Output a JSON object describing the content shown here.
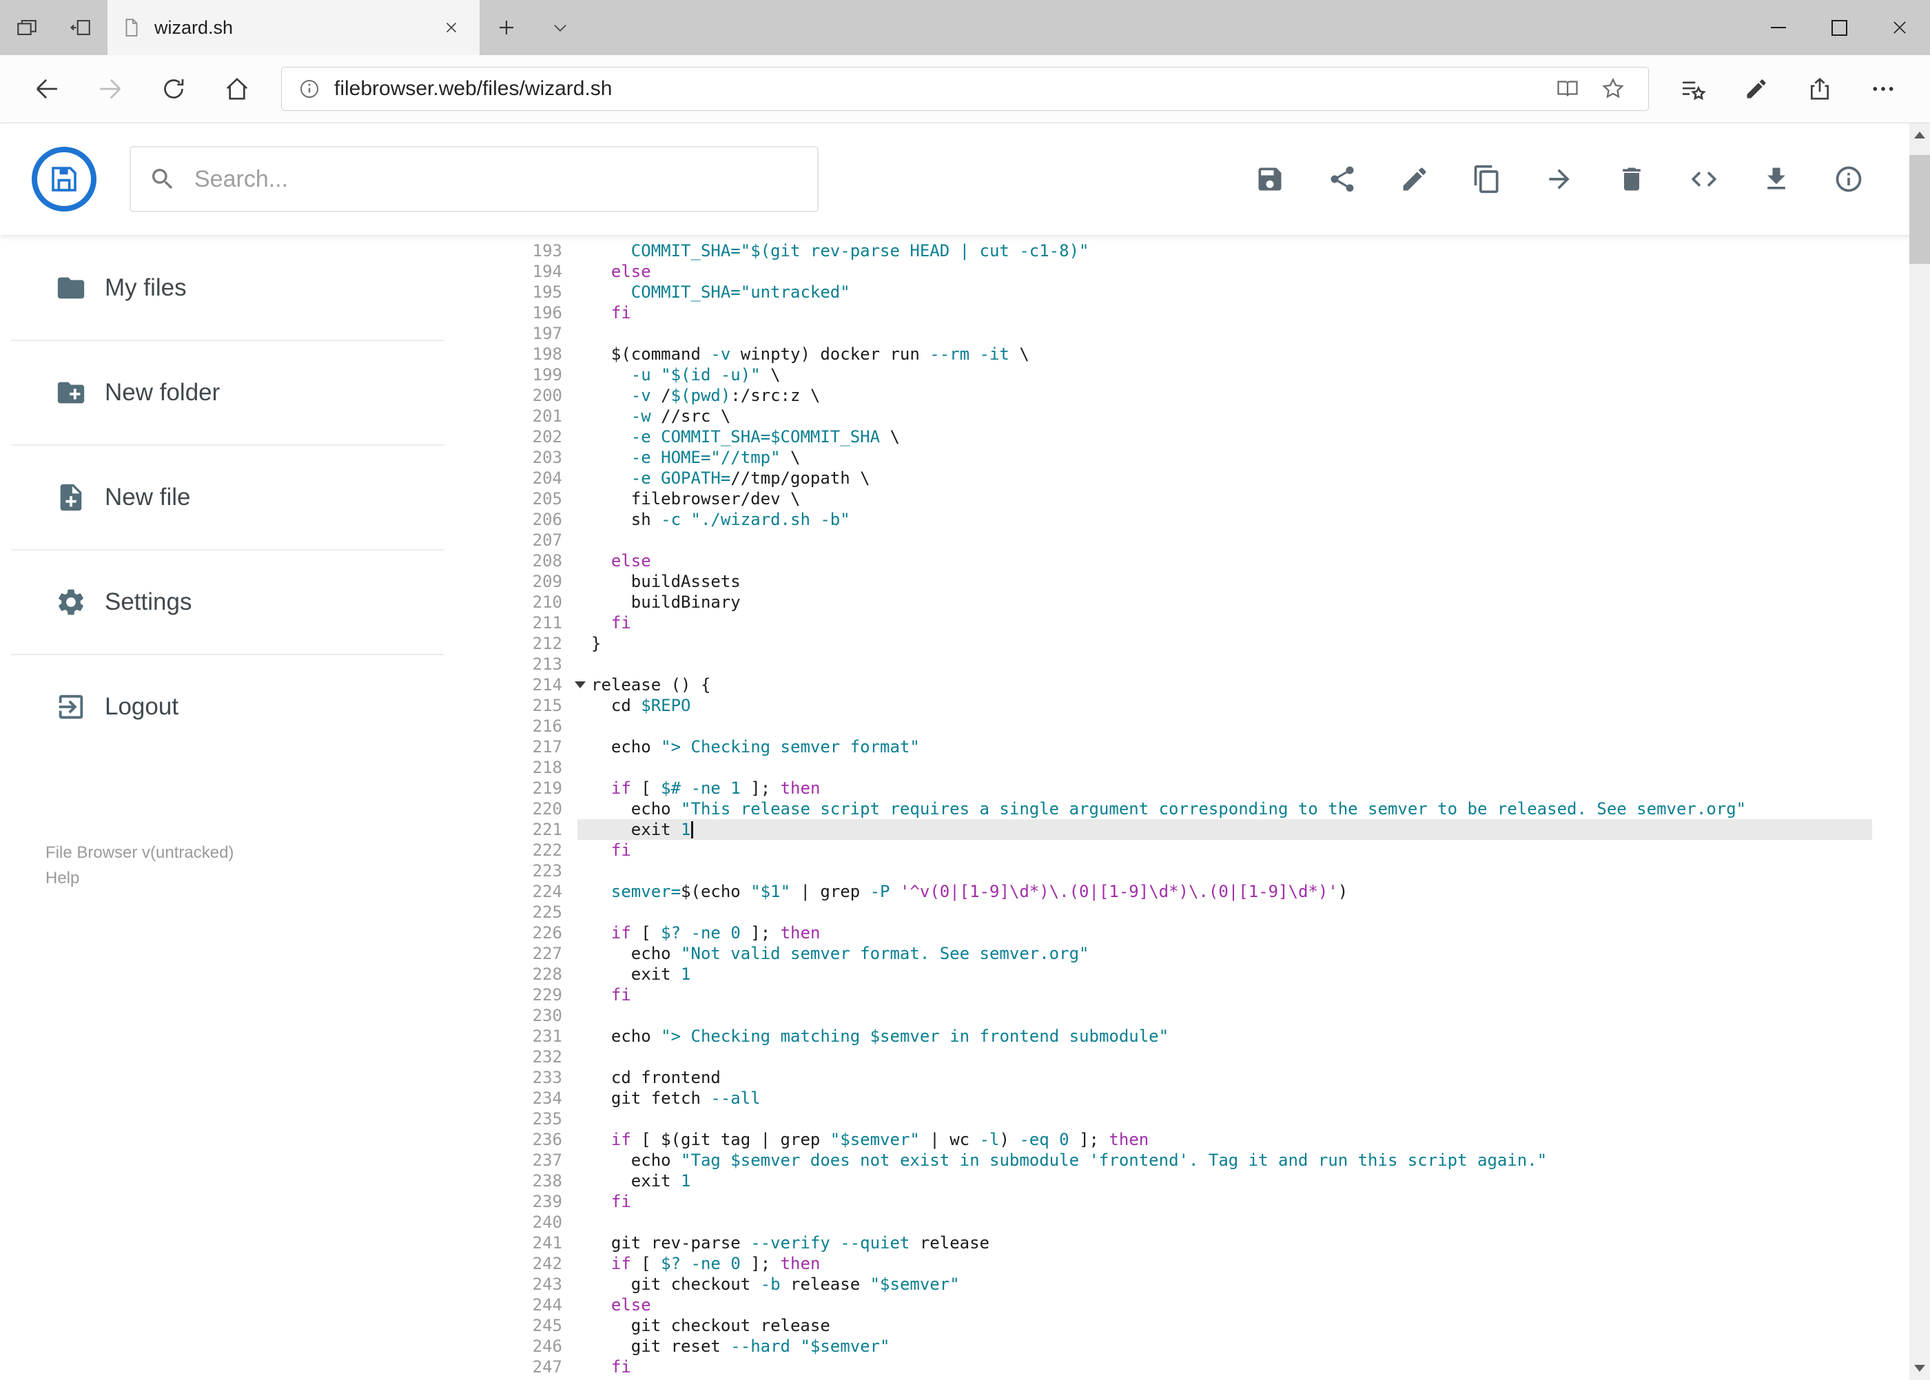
{
  "browser": {
    "tab_title": "wizard.sh",
    "url_domain": "filebrowser.web",
    "url_path": "/files/wizard.sh",
    "tab_bar_icons": [
      "tab-preview",
      "set-tabs-aside",
      "page",
      "close-tab",
      "new-tab",
      "tab-list-chevron"
    ],
    "nav_icons": [
      "back",
      "forward",
      "refresh",
      "home"
    ],
    "address_bar_icons": [
      "site-info",
      "reading-view",
      "favorite-star"
    ],
    "right_icons": [
      "hub-favorites",
      "web-note",
      "share",
      "more-options"
    ],
    "window_controls": [
      "minimize",
      "maximize",
      "close"
    ]
  },
  "header": {
    "search_placeholder": "Search...",
    "action_icons": [
      "save",
      "share",
      "edit",
      "copy",
      "move",
      "delete",
      "code",
      "download",
      "info"
    ]
  },
  "sidebar": {
    "items": [
      {
        "label": "My files",
        "icon": "folder-icon"
      },
      {
        "label": "New folder",
        "icon": "new-folder-icon"
      },
      {
        "label": "New file",
        "icon": "new-file-icon"
      },
      {
        "label": "Settings",
        "icon": "settings-icon"
      },
      {
        "label": "Logout",
        "icon": "logout-icon"
      }
    ],
    "footer_version": "File Browser v(untracked)",
    "footer_help": "Help"
  },
  "colors": {
    "accent_blue": "#1e74d2",
    "toolbar_icon_gray": "#5b6973",
    "sidebar_icon_gray": "#546e7a",
    "keyword_purple": "#a12ea8",
    "string_teal": "#0b7f91",
    "active_line_bg": "#e9e9e9",
    "tab_bar_bg": "#cbcbcb"
  },
  "editor": {
    "first_line": 193,
    "last_line": 247,
    "active_line": 221,
    "cursor_line": 221,
    "cursor_after_text": "exit 1",
    "fold_marker_line": 214,
    "lines": [
      {
        "n": 193,
        "s": [
          [
            "p",
            "    "
          ],
          [
            "v",
            "COMMIT_SHA="
          ],
          [
            "s",
            "\"$(git rev-parse HEAD | cut -c1-8)\""
          ]
        ]
      },
      {
        "n": 194,
        "s": [
          [
            "p",
            "  "
          ],
          [
            "k",
            "else"
          ]
        ]
      },
      {
        "n": 195,
        "s": [
          [
            "p",
            "    "
          ],
          [
            "v",
            "COMMIT_SHA="
          ],
          [
            "s",
            "\"untracked\""
          ]
        ]
      },
      {
        "n": 196,
        "s": [
          [
            "p",
            "  "
          ],
          [
            "k",
            "fi"
          ]
        ]
      },
      {
        "n": 197,
        "s": []
      },
      {
        "n": 198,
        "s": [
          [
            "p",
            "  $(command "
          ],
          [
            "f",
            "-v"
          ],
          [
            "p",
            " winpty) docker run "
          ],
          [
            "f",
            "--rm"
          ],
          [
            "p",
            " "
          ],
          [
            "f",
            "-it"
          ],
          [
            "p",
            " \\"
          ]
        ]
      },
      {
        "n": 199,
        "s": [
          [
            "p",
            "    "
          ],
          [
            "f",
            "-u"
          ],
          [
            "p",
            " "
          ],
          [
            "s",
            "\"$(id -u)\""
          ],
          [
            "p",
            " \\"
          ]
        ]
      },
      {
        "n": 200,
        "s": [
          [
            "p",
            "    "
          ],
          [
            "f",
            "-v"
          ],
          [
            "p",
            " /"
          ],
          [
            "v",
            "$(pwd)"
          ],
          [
            "p",
            ":/src:z \\"
          ]
        ]
      },
      {
        "n": 201,
        "s": [
          [
            "p",
            "    "
          ],
          [
            "f",
            "-w"
          ],
          [
            "p",
            " //src \\"
          ]
        ]
      },
      {
        "n": 202,
        "s": [
          [
            "p",
            "    "
          ],
          [
            "f",
            "-e"
          ],
          [
            "p",
            " "
          ],
          [
            "v",
            "COMMIT_SHA=$COMMIT_SHA"
          ],
          [
            "p",
            " \\"
          ]
        ]
      },
      {
        "n": 203,
        "s": [
          [
            "p",
            "    "
          ],
          [
            "f",
            "-e"
          ],
          [
            "p",
            " "
          ],
          [
            "v",
            "HOME="
          ],
          [
            "s",
            "\"//tmp\""
          ],
          [
            "p",
            " \\"
          ]
        ]
      },
      {
        "n": 204,
        "s": [
          [
            "p",
            "    "
          ],
          [
            "f",
            "-e"
          ],
          [
            "p",
            " "
          ],
          [
            "v",
            "GOPATH="
          ],
          [
            "p",
            "//tmp/gopath \\"
          ]
        ]
      },
      {
        "n": 205,
        "s": [
          [
            "p",
            "    filebrowser/dev \\"
          ]
        ]
      },
      {
        "n": 206,
        "s": [
          [
            "p",
            "    sh "
          ],
          [
            "f",
            "-c"
          ],
          [
            "p",
            " "
          ],
          [
            "s",
            "\"./wizard.sh -b\""
          ]
        ]
      },
      {
        "n": 207,
        "s": []
      },
      {
        "n": 208,
        "s": [
          [
            "p",
            "  "
          ],
          [
            "k",
            "else"
          ]
        ]
      },
      {
        "n": 209,
        "s": [
          [
            "p",
            "    buildAssets"
          ]
        ]
      },
      {
        "n": 210,
        "s": [
          [
            "p",
            "    buildBinary"
          ]
        ]
      },
      {
        "n": 211,
        "s": [
          [
            "p",
            "  "
          ],
          [
            "k",
            "fi"
          ]
        ]
      },
      {
        "n": 212,
        "s": [
          [
            "p",
            "}"
          ]
        ]
      },
      {
        "n": 213,
        "s": []
      },
      {
        "n": 214,
        "s": [
          [
            "p",
            "release () {"
          ]
        ]
      },
      {
        "n": 215,
        "s": [
          [
            "p",
            "  cd "
          ],
          [
            "v",
            "$REPO"
          ]
        ]
      },
      {
        "n": 216,
        "s": []
      },
      {
        "n": 217,
        "s": [
          [
            "p",
            "  echo "
          ],
          [
            "s",
            "\"> Checking semver format\""
          ]
        ]
      },
      {
        "n": 218,
        "s": []
      },
      {
        "n": 219,
        "s": [
          [
            "p",
            "  "
          ],
          [
            "k",
            "if"
          ],
          [
            "p",
            " [ "
          ],
          [
            "v",
            "$#"
          ],
          [
            "p",
            " "
          ],
          [
            "f",
            "-ne"
          ],
          [
            "p",
            " "
          ],
          [
            "num",
            "1"
          ],
          [
            "p",
            " ]; "
          ],
          [
            "k",
            "then"
          ]
        ]
      },
      {
        "n": 220,
        "s": [
          [
            "p",
            "    echo "
          ],
          [
            "s",
            "\"This release script requires a single argument corresponding to the semver to be released. See semver.org\""
          ]
        ]
      },
      {
        "n": 221,
        "s": [
          [
            "p",
            "    exit "
          ],
          [
            "num",
            "1"
          ]
        ]
      },
      {
        "n": 222,
        "s": [
          [
            "p",
            "  "
          ],
          [
            "k",
            "fi"
          ]
        ]
      },
      {
        "n": 223,
        "s": []
      },
      {
        "n": 224,
        "s": [
          [
            "p",
            "  "
          ],
          [
            "v",
            "semver="
          ],
          [
            "p",
            "$(echo "
          ],
          [
            "s",
            "\"$1\""
          ],
          [
            "p",
            " | grep "
          ],
          [
            "f",
            "-P"
          ],
          [
            "p",
            " "
          ],
          [
            "r",
            "'^v(0|[1-9]\\d*)\\.(0|[1-9]\\d*)\\.(0|[1-9]\\d*)'"
          ],
          [
            "p",
            ")"
          ]
        ]
      },
      {
        "n": 225,
        "s": []
      },
      {
        "n": 226,
        "s": [
          [
            "p",
            "  "
          ],
          [
            "k",
            "if"
          ],
          [
            "p",
            " [ "
          ],
          [
            "v",
            "$?"
          ],
          [
            "p",
            " "
          ],
          [
            "f",
            "-ne"
          ],
          [
            "p",
            " "
          ],
          [
            "num",
            "0"
          ],
          [
            "p",
            " ]; "
          ],
          [
            "k",
            "then"
          ]
        ]
      },
      {
        "n": 227,
        "s": [
          [
            "p",
            "    echo "
          ],
          [
            "s",
            "\"Not valid semver format. See semver.org\""
          ]
        ]
      },
      {
        "n": 228,
        "s": [
          [
            "p",
            "    exit "
          ],
          [
            "num",
            "1"
          ]
        ]
      },
      {
        "n": 229,
        "s": [
          [
            "p",
            "  "
          ],
          [
            "k",
            "fi"
          ]
        ]
      },
      {
        "n": 230,
        "s": []
      },
      {
        "n": 231,
        "s": [
          [
            "p",
            "  echo "
          ],
          [
            "s",
            "\"> Checking matching "
          ],
          [
            "v",
            "$semver"
          ],
          [
            "s",
            " in frontend submodule\""
          ]
        ]
      },
      {
        "n": 232,
        "s": []
      },
      {
        "n": 233,
        "s": [
          [
            "p",
            "  cd frontend"
          ]
        ]
      },
      {
        "n": 234,
        "s": [
          [
            "p",
            "  git fetch "
          ],
          [
            "f",
            "--all"
          ]
        ]
      },
      {
        "n": 235,
        "s": []
      },
      {
        "n": 236,
        "s": [
          [
            "p",
            "  "
          ],
          [
            "k",
            "if"
          ],
          [
            "p",
            " [ $(git tag | grep "
          ],
          [
            "s",
            "\"$semver\""
          ],
          [
            "p",
            " | wc "
          ],
          [
            "f",
            "-l"
          ],
          [
            "p",
            ") "
          ],
          [
            "f",
            "-eq"
          ],
          [
            "p",
            " "
          ],
          [
            "num",
            "0"
          ],
          [
            "p",
            " ]; "
          ],
          [
            "k",
            "then"
          ]
        ]
      },
      {
        "n": 237,
        "s": [
          [
            "p",
            "    echo "
          ],
          [
            "s",
            "\"Tag "
          ],
          [
            "v",
            "$semver"
          ],
          [
            "s",
            " does not exist in submodule 'frontend'. Tag it and run this script again.\""
          ]
        ]
      },
      {
        "n": 238,
        "s": [
          [
            "p",
            "    exit "
          ],
          [
            "num",
            "1"
          ]
        ]
      },
      {
        "n": 239,
        "s": [
          [
            "p",
            "  "
          ],
          [
            "k",
            "fi"
          ]
        ]
      },
      {
        "n": 240,
        "s": []
      },
      {
        "n": 241,
        "s": [
          [
            "p",
            "  git rev-parse "
          ],
          [
            "f",
            "--verify"
          ],
          [
            "p",
            " "
          ],
          [
            "f",
            "--quiet"
          ],
          [
            "p",
            " release"
          ]
        ]
      },
      {
        "n": 242,
        "s": [
          [
            "p",
            "  "
          ],
          [
            "k",
            "if"
          ],
          [
            "p",
            " [ "
          ],
          [
            "v",
            "$?"
          ],
          [
            "p",
            " "
          ],
          [
            "f",
            "-ne"
          ],
          [
            "p",
            " "
          ],
          [
            "num",
            "0"
          ],
          [
            "p",
            " ]; "
          ],
          [
            "k",
            "then"
          ]
        ]
      },
      {
        "n": 243,
        "s": [
          [
            "p",
            "    git checkout "
          ],
          [
            "f",
            "-b"
          ],
          [
            "p",
            " release "
          ],
          [
            "s",
            "\"$semver\""
          ]
        ]
      },
      {
        "n": 244,
        "s": [
          [
            "p",
            "  "
          ],
          [
            "k",
            "else"
          ]
        ]
      },
      {
        "n": 245,
        "s": [
          [
            "p",
            "    git checkout release"
          ]
        ]
      },
      {
        "n": 246,
        "s": [
          [
            "p",
            "    git reset "
          ],
          [
            "f",
            "--hard"
          ],
          [
            "p",
            " "
          ],
          [
            "s",
            "\"$semver\""
          ]
        ]
      },
      {
        "n": 247,
        "s": [
          [
            "p",
            "  "
          ],
          [
            "k",
            "fi"
          ]
        ]
      }
    ]
  }
}
